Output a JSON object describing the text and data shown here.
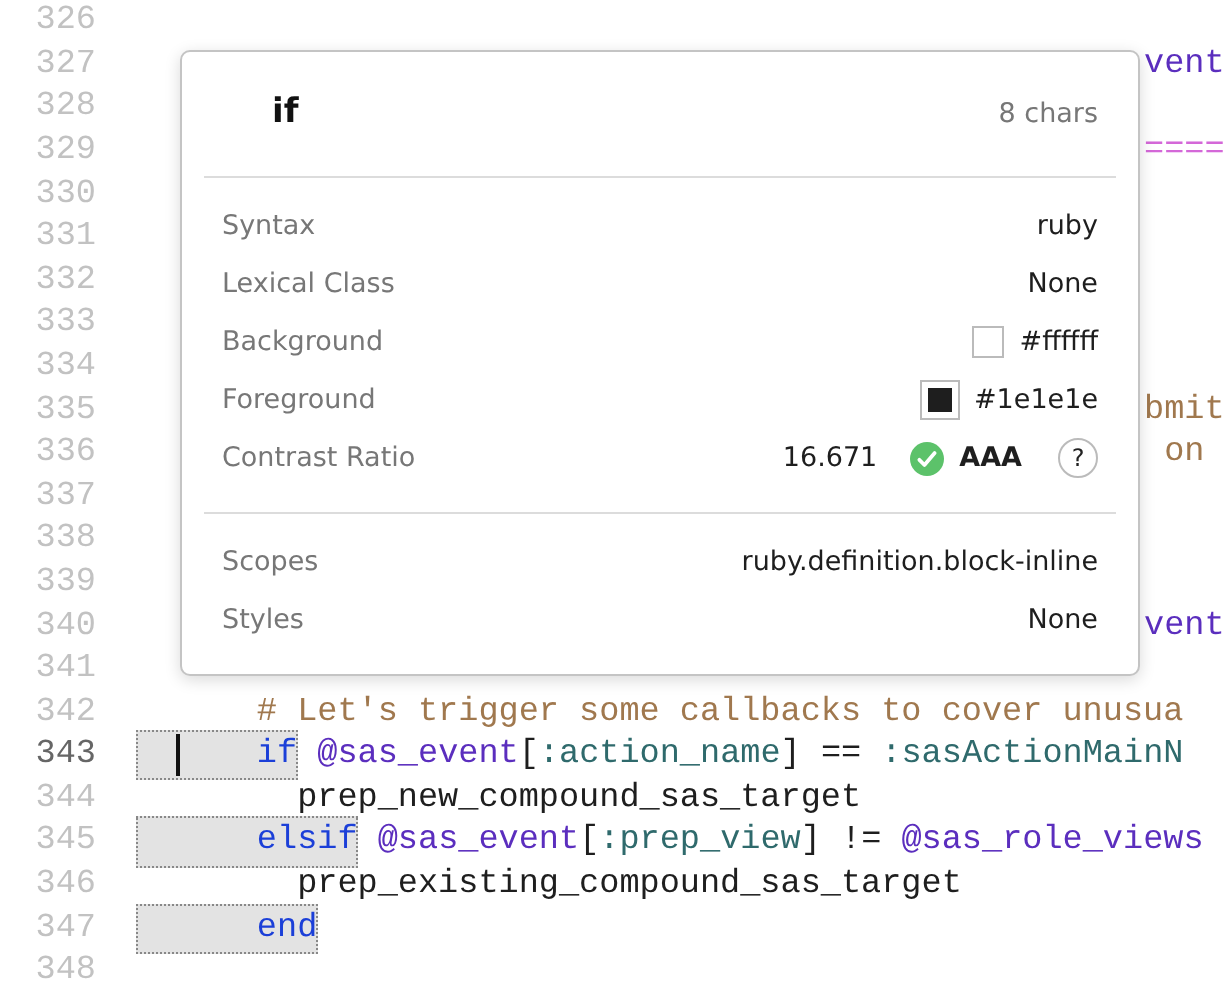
{
  "editor": {
    "lines": [
      {
        "number": "326",
        "current": false
      },
      {
        "number": "327",
        "current": false,
        "fragment": true,
        "segments": [
          {
            "text": "vent",
            "kind": "ivar"
          }
        ]
      },
      {
        "number": "328",
        "current": false
      },
      {
        "number": "329",
        "current": false,
        "fragment": true,
        "segments": [
          {
            "text": "====",
            "kind": "string"
          }
        ]
      },
      {
        "number": "330",
        "current": false
      },
      {
        "number": "331",
        "current": false
      },
      {
        "number": "332",
        "current": false
      },
      {
        "number": "333",
        "current": false
      },
      {
        "number": "334",
        "current": false
      },
      {
        "number": "335",
        "current": false,
        "fragment": true,
        "segments": [
          {
            "text": "bmit",
            "kind": "comment"
          }
        ]
      },
      {
        "number": "336",
        "current": false,
        "fragment": true,
        "segments": [
          {
            "text": " on",
            "kind": "comment"
          }
        ]
      },
      {
        "number": "337",
        "current": false
      },
      {
        "number": "338",
        "current": false
      },
      {
        "number": "339",
        "current": false
      },
      {
        "number": "340",
        "current": false,
        "fragment": true,
        "segments": [
          {
            "text": "vent",
            "kind": "ivar"
          }
        ]
      },
      {
        "number": "341",
        "current": false
      },
      {
        "number": "342",
        "current": false,
        "segments": [
          {
            "text": "      # Let's trigger some callbacks to cover unusua",
            "kind": "comment"
          }
        ]
      },
      {
        "number": "343",
        "current": true,
        "highlighted": true,
        "cursor": true,
        "segments": [
          {
            "text": "      if",
            "kind": "keyword"
          },
          {
            "text": " @sas_event",
            "kind": "ivar"
          },
          {
            "text": "[",
            "kind": "plain"
          },
          {
            "text": ":action_name",
            "kind": "symbol"
          },
          {
            "text": "] == ",
            "kind": "plain"
          },
          {
            "text": ":sasActionMainN",
            "kind": "symbol"
          }
        ]
      },
      {
        "number": "344",
        "current": false,
        "segments": [
          {
            "text": "        prep_new_compound_sas_target",
            "kind": "plain"
          }
        ]
      },
      {
        "number": "345",
        "current": false,
        "highlighted": true,
        "segments": [
          {
            "text": "      elsif",
            "kind": "keyword"
          },
          {
            "text": " @sas_event",
            "kind": "ivar"
          },
          {
            "text": "[",
            "kind": "plain"
          },
          {
            "text": ":prep_view",
            "kind": "symbol"
          },
          {
            "text": "] != ",
            "kind": "plain"
          },
          {
            "text": "@sas_role_views",
            "kind": "ivar"
          }
        ]
      },
      {
        "number": "346",
        "current": false,
        "segments": [
          {
            "text": "        prep_existing_compound_sas_target",
            "kind": "plain"
          }
        ]
      },
      {
        "number": "347",
        "current": false,
        "highlighted": true,
        "segments": [
          {
            "text": "      end",
            "kind": "keyword"
          }
        ]
      },
      {
        "number": "348",
        "current": false
      }
    ]
  },
  "popover": {
    "token": "if",
    "length": "8 chars",
    "rows": [
      {
        "kind": "text",
        "label": "Syntax",
        "value": "ruby"
      },
      {
        "kind": "text",
        "label": "Lexical Class",
        "value": "None"
      },
      {
        "kind": "color",
        "label": "Background",
        "value": "#ffffff",
        "color": "#ffffff"
      },
      {
        "kind": "color",
        "label": "Foreground",
        "value": "#1e1e1e",
        "color": "#1e1e1e"
      },
      {
        "kind": "contrast",
        "label": "Contrast Ratio",
        "value": "16.671",
        "rating": "AAA",
        "help": "?"
      }
    ],
    "scope_rows": [
      {
        "label": "Scopes",
        "value": "ruby.definition.block-inline"
      },
      {
        "label": "Styles",
        "value": "None"
      }
    ]
  }
}
